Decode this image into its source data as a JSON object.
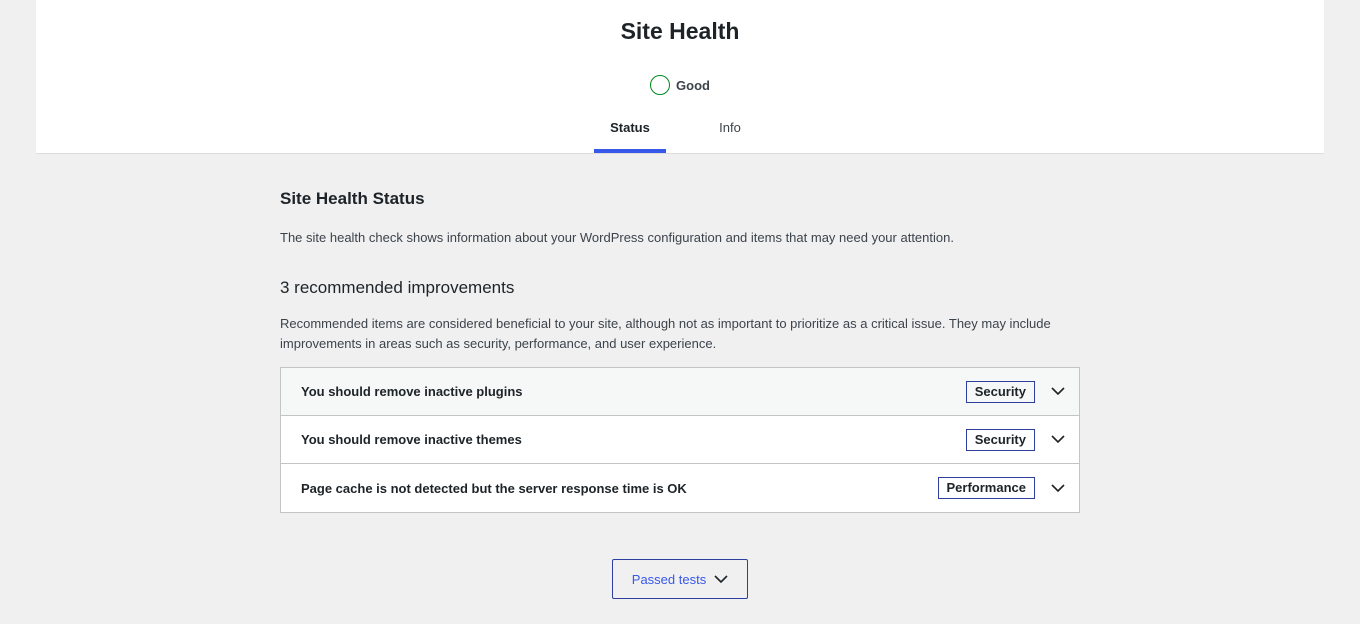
{
  "header": {
    "title": "Site Health",
    "status_label": "Good",
    "status_color": "#008a20",
    "tabs": [
      {
        "label": "Status",
        "active": true
      },
      {
        "label": "Info",
        "active": false
      }
    ]
  },
  "status": {
    "title": "Site Health Status",
    "description": "The site health check shows information about your WordPress configuration and items that may need your attention."
  },
  "improvements": {
    "title": "3 recommended improvements",
    "description": "Recommended items are considered beneficial to your site, although not as important to prioritize as a critical issue. They may include improvements in areas such as security, performance, and user experience.",
    "items": [
      {
        "label": "You should remove inactive plugins",
        "badge": "Security",
        "icon": "chevron-down-icon"
      },
      {
        "label": "You should remove inactive themes",
        "badge": "Security",
        "icon": "chevron-down-icon"
      },
      {
        "label": "Page cache is not detected but the server response time is OK",
        "badge": "Performance",
        "icon": "chevron-down-icon"
      }
    ]
  },
  "passed": {
    "label": "Passed tests",
    "icon": "chevron-down-icon"
  },
  "colors": {
    "accent": "#3858e9",
    "badge_border": "#2c3e9e",
    "background": "#f0f0f1"
  }
}
